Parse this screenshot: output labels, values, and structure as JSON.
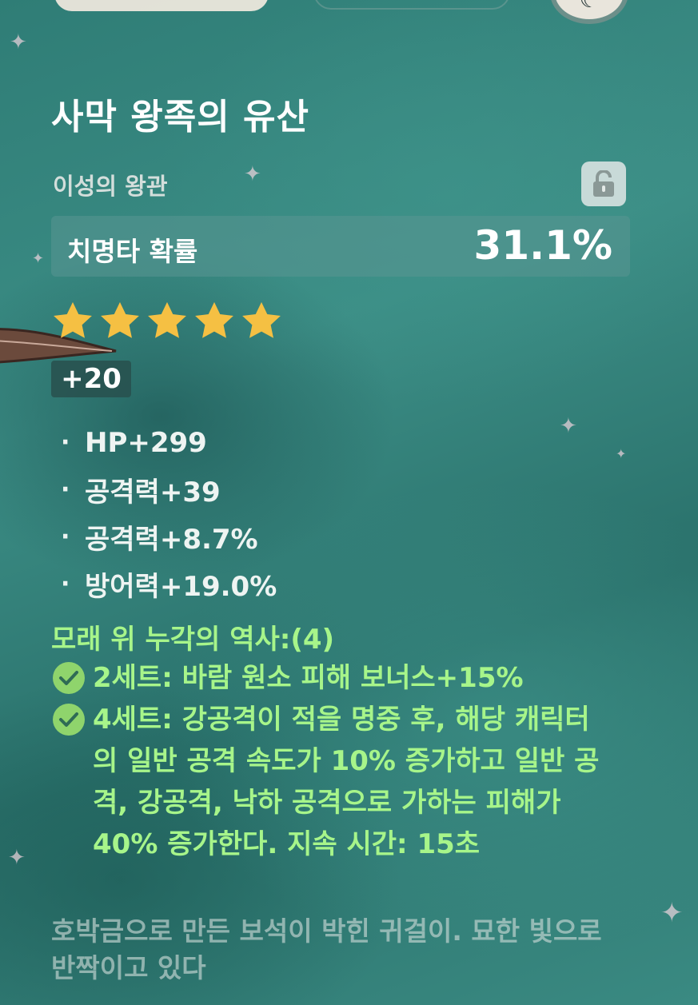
{
  "artifact": {
    "name": "사막 왕족의 유산",
    "slot": "이성의 왕관",
    "lock_icon": "unlock-icon",
    "main_stat": {
      "name": "치명타 확률",
      "value": "31.1%"
    },
    "rarity": 5,
    "level": "+20",
    "substats": [
      {
        "bullet": "·",
        "text": "HP+299"
      },
      {
        "bullet": "·",
        "text": "공격력+39"
      },
      {
        "bullet": "·",
        "text": "공격력+8.7%"
      },
      {
        "bullet": "·",
        "text": "방어력+19.0%"
      }
    ],
    "set": {
      "name": "모래 위 누각의 역사:(4)",
      "bonuses": [
        {
          "text": "2세트: 바람 원소 피해 보너스+15%"
        },
        {
          "text": "4세트: 강공격이 적을 명중 후, 해당 캐릭터의 일반 공격 속도가 10% 증가하고 일반 공격, 강공격, 낙하 공격으로 가하는 피해가 40% 증가한다. 지속 시간: 15초"
        }
      ]
    },
    "description": "호박금으로 만든 보석이 박힌 귀걸이. 묘한 빛으로 반짝이고 있다"
  },
  "colors": {
    "set_text": "#a7f58a",
    "star": "#f5c043",
    "check": "#8fd46c"
  }
}
